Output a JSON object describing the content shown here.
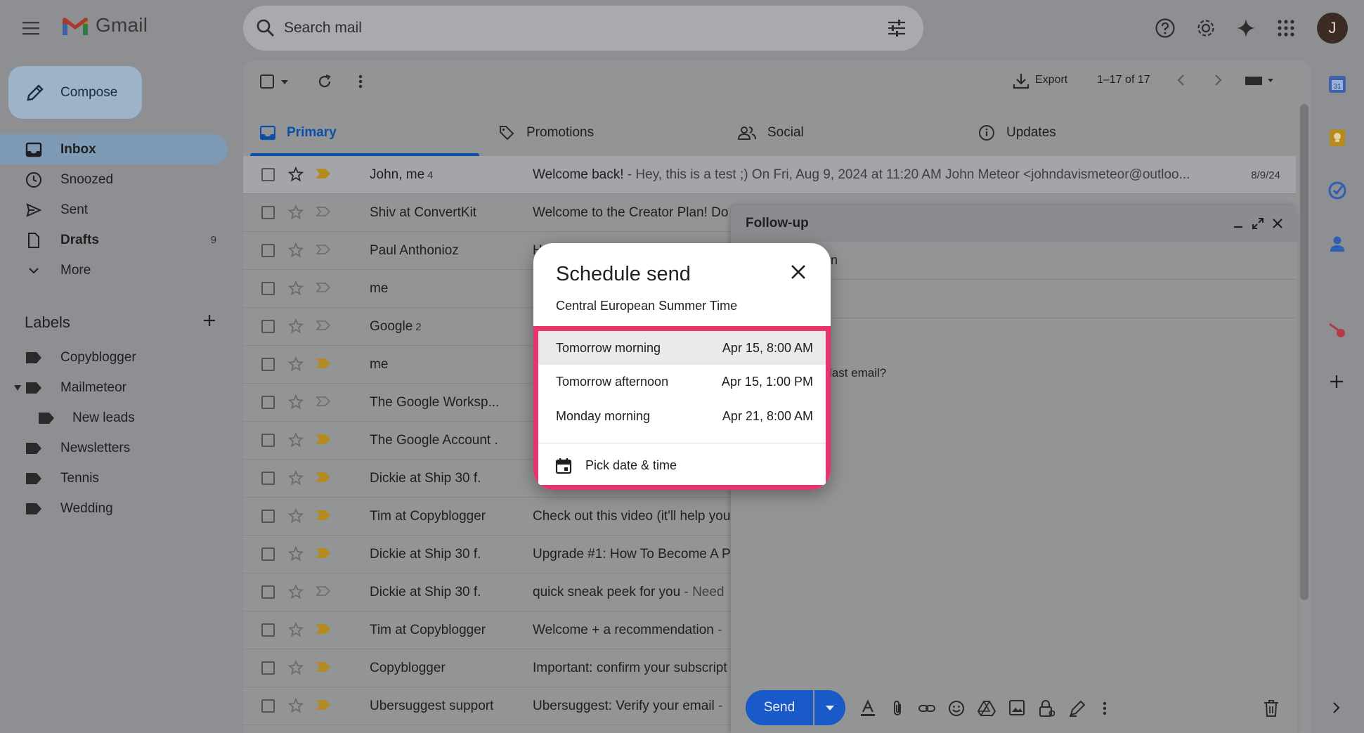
{
  "app": {
    "name": "Gmail"
  },
  "search": {
    "placeholder": "Search mail"
  },
  "avatar_letter": "J",
  "sidebar": {
    "compose_label": "Compose",
    "items": [
      {
        "label": "Inbox",
        "count": "",
        "icon": "inbox-icon"
      },
      {
        "label": "Snoozed",
        "count": "",
        "icon": "clock-icon"
      },
      {
        "label": "Sent",
        "count": "",
        "icon": "send-icon"
      },
      {
        "label": "Drafts",
        "count": "9",
        "icon": "draft-icon"
      },
      {
        "label": "More",
        "count": "",
        "icon": "chevron-down-icon"
      }
    ],
    "labels_title": "Labels",
    "labels": [
      {
        "name": "Copyblogger"
      },
      {
        "name": "Mailmeteor"
      },
      {
        "name": "New leads"
      },
      {
        "name": "Newsletters"
      },
      {
        "name": "Tennis"
      },
      {
        "name": "Wedding"
      }
    ]
  },
  "toolbar": {
    "export_label": "Export",
    "pagination": "1–17 of 17"
  },
  "tabs": [
    {
      "label": "Primary"
    },
    {
      "label": "Promotions"
    },
    {
      "label": "Social"
    },
    {
      "label": "Updates"
    }
  ],
  "emails": [
    {
      "sender": "John, me",
      "count": "4",
      "subject": "Welcome back!",
      "snippet": " - Hey, this is a test ;) On Fri, Aug 9, 2024 at 11:20 AM John Meteor <johndavismeteor@outloo...",
      "date": "8/9/24",
      "important": true
    },
    {
      "sender": "Shiv at ConvertKit",
      "count": "",
      "subject": "Welcome to the Creator Plan! Do",
      "snippet": "",
      "date": "",
      "important": false
    },
    {
      "sender": "Paul Anthonioz",
      "count": "",
      "subject": "H",
      "snippet": "",
      "date": "",
      "important": false
    },
    {
      "sender": "me",
      "count": "",
      "subject": "",
      "snippet": "",
      "date": "",
      "important": false
    },
    {
      "sender": "Google",
      "count": "2",
      "subject": "",
      "snippet": "",
      "date": "",
      "important": false
    },
    {
      "sender": "me",
      "count": "",
      "subject": "",
      "snippet": "",
      "date": "",
      "important": true
    },
    {
      "sender": "The Google Worksp...",
      "count": "",
      "subject": "",
      "snippet": "",
      "date": "",
      "important": false
    },
    {
      "sender": "The Google Account .",
      "count": "",
      "subject": "",
      "snippet": "",
      "date": "",
      "important": true
    },
    {
      "sender": "Dickie at Ship 30 f.",
      "count": "",
      "subject": "",
      "snippet": "",
      "date": "",
      "important": true
    },
    {
      "sender": "Tim at Copyblogger",
      "count": "",
      "subject": "Check out this video (it'll help you",
      "snippet": "",
      "date": "",
      "important": true
    },
    {
      "sender": "Dickie at Ship 30 f.",
      "count": "",
      "subject": "Upgrade #1: How To Become A P",
      "snippet": "",
      "date": "",
      "important": true
    },
    {
      "sender": "Dickie at Ship 30 f.",
      "count": "",
      "subject": "quick sneak peek for you",
      "snippet": " - Need",
      "date": "",
      "important": false
    },
    {
      "sender": "Tim at Copyblogger",
      "count": "",
      "subject": "Welcome + a recommendation",
      "snippet": " - ",
      "date": "",
      "important": true
    },
    {
      "sender": "Copyblogger",
      "count": "",
      "subject": "Important: confirm your subscript",
      "snippet": "",
      "date": "",
      "important": true
    },
    {
      "sender": "Ubersuggest support",
      "count": "",
      "subject": "Ubersuggest: Verify your email",
      "snippet": " - ",
      "date": "",
      "important": true
    }
  ],
  "compose_window": {
    "title": "Follow-up",
    "to_fragment": "n",
    "body_fragment": "last email?",
    "send_label": "Send"
  },
  "schedule_dialog": {
    "title": "Schedule send",
    "timezone": "Central European Summer Time",
    "options": [
      {
        "label": "Tomorrow morning",
        "time": "Apr 15, 8:00 AM"
      },
      {
        "label": "Tomorrow afternoon",
        "time": "Apr 15, 1:00 PM"
      },
      {
        "label": "Monday morning",
        "time": "Apr 21, 8:00 AM"
      }
    ],
    "pick_label": "Pick date & time"
  },
  "colors": {
    "highlight_border": "#e8336b",
    "primary_blue": "#0b4fa8",
    "send_blue": "#1a5ac8"
  }
}
